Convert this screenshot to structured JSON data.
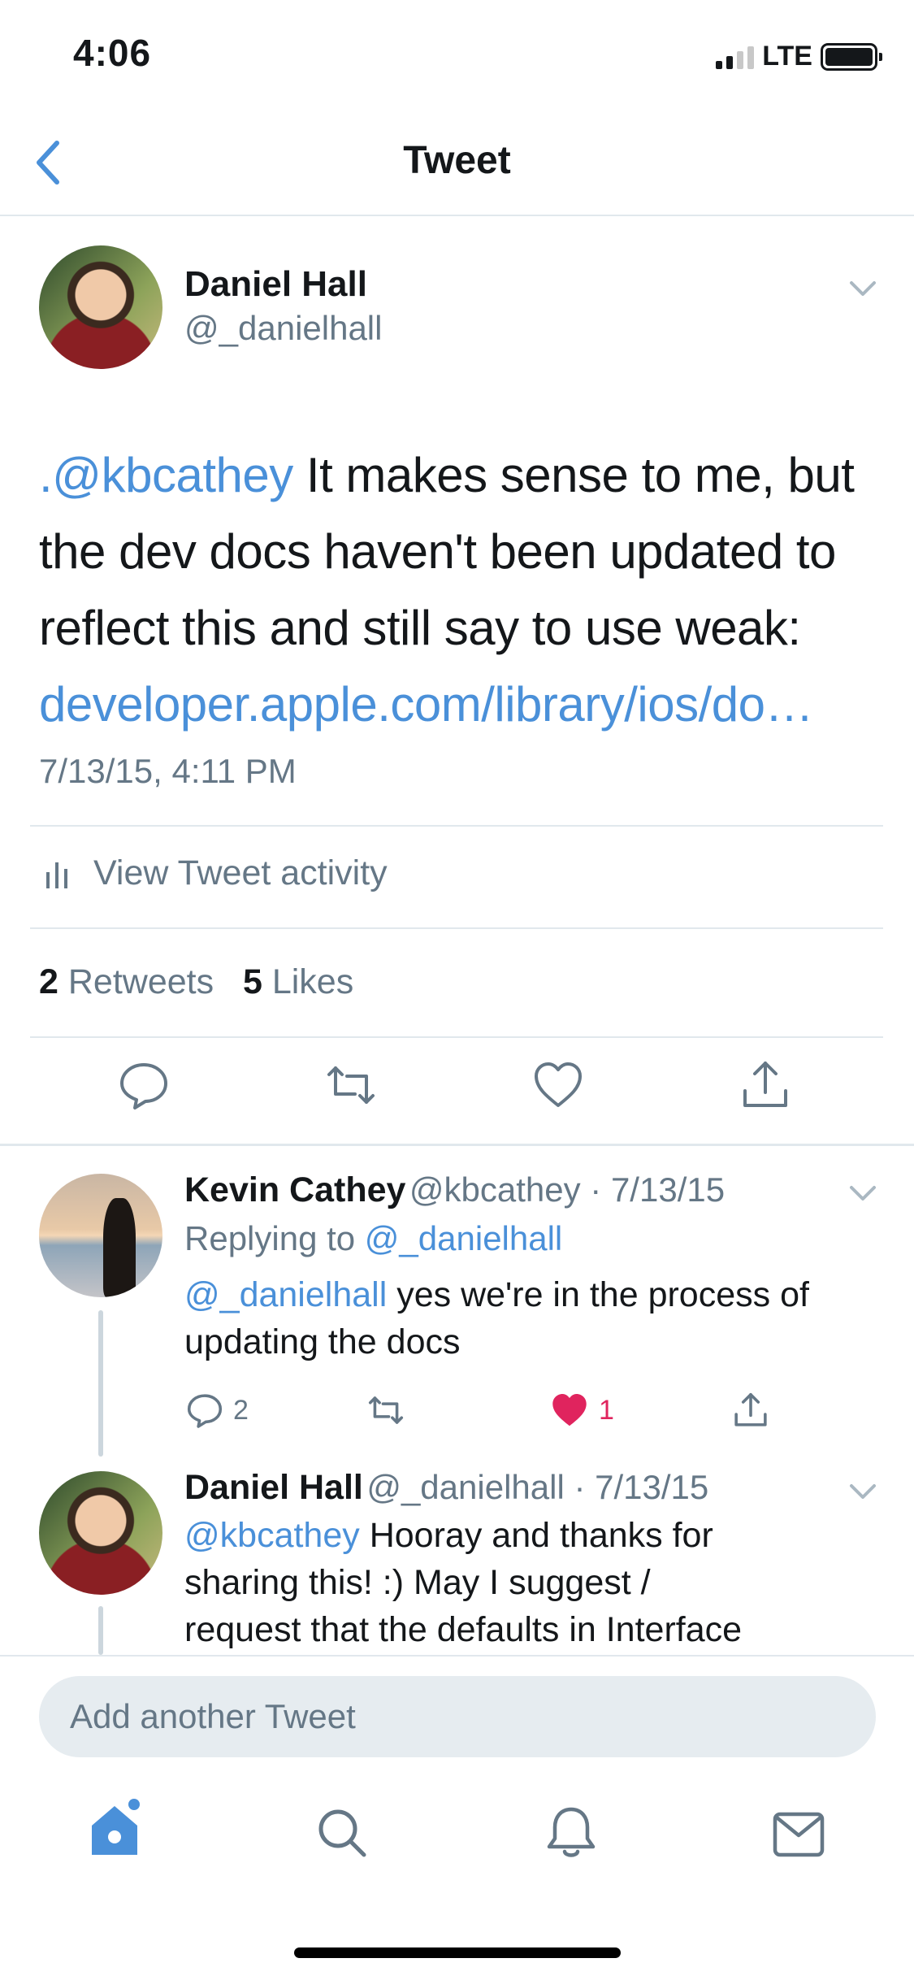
{
  "status_bar": {
    "time": "4:06",
    "network": "LTE"
  },
  "nav": {
    "title": "Tweet",
    "back_icon": "chevron-left-icon"
  },
  "tweet": {
    "author_name": "Daniel Hall",
    "author_handle": "@_danielhall",
    "text_prefix": ".",
    "mention": "@kbcathey",
    "text_body": " It makes sense to me, but the dev docs haven't been updated to reflect this and still say to use weak: ",
    "link": "developer.apple.com/library/ios/do…",
    "timestamp": "7/13/15, 4:11 PM",
    "activity_label": "View Tweet activity",
    "retweets_count": "2",
    "retweets_label": "Retweets",
    "likes_count": "5",
    "likes_label": "Likes"
  },
  "replies": [
    {
      "name": "Kevin Cathey",
      "handle_date": "@kbcathey · 7/13/15",
      "replying_label": "Replying to",
      "replying_to": "@_danielhall",
      "mention": "@_danielhall",
      "text": " yes we're in the process of",
      "text_line2": "updating the docs",
      "reply_count": "2",
      "like_count": "1"
    },
    {
      "name": "Daniel Hall",
      "handle_date": "@_danielhall · 7/13/15",
      "mention": "@kbcathey",
      "text": " Hooray and thanks for",
      "text_line2": "sharing this!  :)   May I suggest /",
      "text_line3": "request that the defaults in Interface"
    }
  ],
  "compose": {
    "placeholder": "Add another Tweet"
  },
  "tab_bar": {
    "items": [
      "home-icon",
      "search-icon",
      "notifications-icon",
      "messages-icon"
    ]
  },
  "colors": {
    "accent": "#4a90d9",
    "like": "#e0245e",
    "text_secondary": "#657786"
  }
}
